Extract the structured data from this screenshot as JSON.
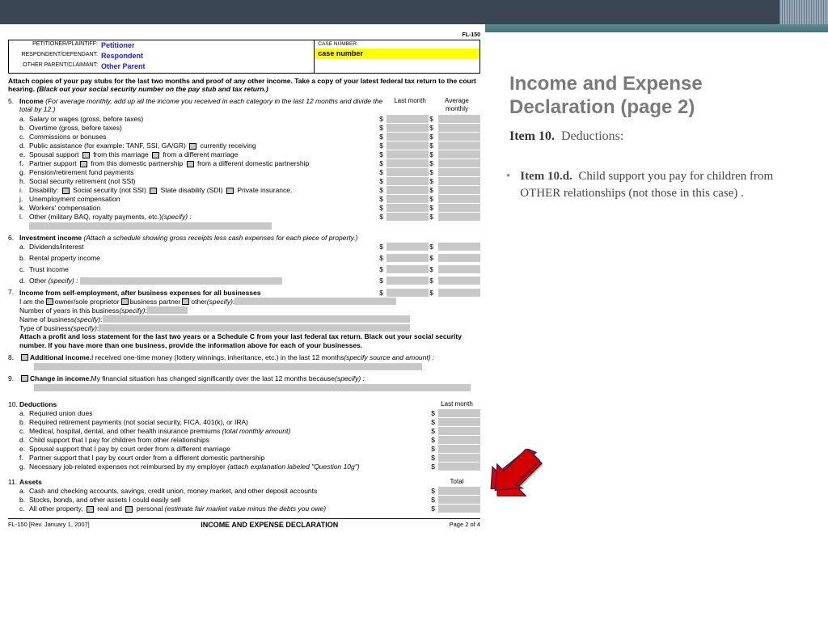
{
  "form_code": "FL-150",
  "header": {
    "petitioner_label": "PETITIONER/PLAINTIFF:",
    "petitioner": "Petitioner",
    "respondent_label": "RESPONDENT/DEFENDANT:",
    "respondent": "Respondent",
    "other_label": "OTHER PARENT/CLAIMANT:",
    "other": "Other Parent",
    "case_number_label": "CASE NUMBER:",
    "case_number": "case number"
  },
  "instructions": {
    "line1": "Attach copies of your pay stubs for the last two months and proof of any other income. Take a copy of your latest federal tax return to the court hearing.",
    "line2": "(Black out your social security number on the pay stub and tax return.)"
  },
  "columns": {
    "last_month": "Last month",
    "avg_monthly": "Average monthly",
    "total": "Total"
  },
  "s5": {
    "num": "5.",
    "title": "Income",
    "note": "(For average monthly, add up all the income you received in each category in the last 12 months and divide the total by 12.)",
    "a": "Salary or wages (gross, before taxes)",
    "b": "Overtime (gross, before taxes)",
    "c": "Commissions or bonuses",
    "d": "Public assistance (for example: TANF, SSI, GA/GR)",
    "d_opt": "currently receiving",
    "e": "Spousal support",
    "e_opt1": "from this marriage",
    "e_opt2": "from a different marriage",
    "f": "Partner support",
    "f_opt1": "from this domestic partnership",
    "f_opt2": "from a different domestic partnership",
    "g": "Pension/retirement fund payments",
    "h": "Social security retirement (not SSI)",
    "i": "Disability:",
    "i_opt1": "Social security (not SSI)",
    "i_opt2": "State disability (SDI)",
    "i_opt3": "Private insurance.",
    "j": "Unemployment compensation",
    "k": "Workers' compensation",
    "l": "Other (military BAQ, royalty payments, etc.)",
    "specify": "(specify) :"
  },
  "s6": {
    "num": "6.",
    "title": "Investment income",
    "note": "(Attach a schedule showing gross receipts less cash expenses for each piece of property.)",
    "a": "Dividends/interest",
    "b": "Rental property income",
    "c": "Trust income",
    "d": "Other",
    "specify": "(specify) :"
  },
  "s7": {
    "num": "7.",
    "title": "Income from self-employment, after business expenses for all businesses",
    "iam": "I am the",
    "opt1": "owner/sole proprietor",
    "opt2": "business partner",
    "opt3": "other",
    "specify": "(specify)",
    "years": "Number of years in this business",
    "bname": "Name of business",
    "btype": "Type of business",
    "attach": "Attach a profit and loss statement for the last two years or a Schedule C from your last federal tax return. Black out your social security number. If you have more than one business, provide the information above for each of your businesses."
  },
  "s8": {
    "num": "8.",
    "title": "Additional income.",
    "text": "I received one-time money (lottery winnings, inheritance, etc.) in the last 12 months",
    "specify": "(specify source and amount) :"
  },
  "s9": {
    "num": "9.",
    "title": "Change in income.",
    "text": "My financial situation has changed significantly over the last 12 months because",
    "specify": "(specify) :"
  },
  "s10": {
    "num": "10.",
    "title": "Deductions",
    "a": "Required union dues",
    "b": "Required retirement payments (not social security, FICA, 401(k), or IRA)",
    "c": "Medical, hospital, dental, and other health insurance premiums",
    "c_note": "(total monthly amount)",
    "d": "Child support that I pay for children from other relationships",
    "e": "Spousal support that I pay by court order from a different marriage",
    "f": "Partner support that I pay by court order from a different domestic partnership",
    "g": "Necessary job-related expenses not reimbursed by my employer",
    "g_note": "(attach explanation labeled \"Question 10g\")"
  },
  "s11": {
    "num": "11.",
    "title": "Assets",
    "a": "Cash and checking accounts, savings, credit union, money market, and other deposit accounts",
    "b": "Stocks, bonds, and other assets I could easily sell",
    "c": "All other property,",
    "c_opt1": "real and",
    "c_opt2": "personal",
    "c_note": "(estimate fair market value minus the debts you owe)"
  },
  "footer": {
    "left": "FL-150 [Rev. January 1, 2007]",
    "center": "INCOME AND EXPENSE DECLARATION",
    "right": "Page 2 of 4"
  },
  "right_panel": {
    "title": "Income and Expense Declaration (page 2)",
    "item10_label": "Item 10.",
    "item10_text": "Deductions:",
    "item10d_label": "Item 10.d.",
    "item10d_text": "Child support you pay for children from OTHER relationships (not those in this case) ."
  }
}
